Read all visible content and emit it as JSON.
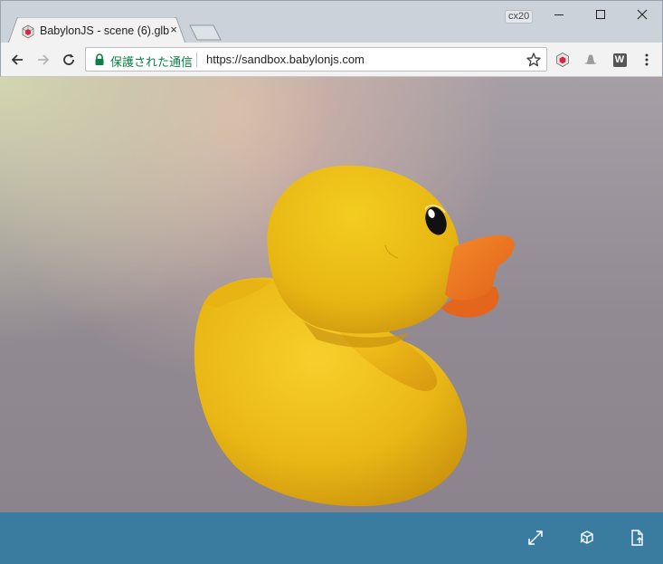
{
  "browser": {
    "tab": {
      "title": "BabylonJS - scene (6).glb",
      "favicon": "babylonjs-cube-icon",
      "close_label": "×"
    },
    "profile_badge": "cx20",
    "window_controls": {
      "minimize": "minimize-icon",
      "maximize": "maximize-icon",
      "close": "close-window-icon"
    }
  },
  "toolbar": {
    "back": "back-arrow-icon",
    "forward": "forward-arrow-icon",
    "reload": "reload-icon",
    "security_label": "保護された通信",
    "url": "https://sandbox.babylonjs.com",
    "bookmark": "star-icon",
    "extensions": [
      "babylonjs-extension-icon",
      "hat-extension-icon",
      "w-extension-icon"
    ],
    "extension_w_label": "W",
    "menu": "kebab-menu-icon"
  },
  "viewport": {
    "model": "rubber-duck",
    "colors": {
      "duck_body": "#f2c21a",
      "duck_beak": "#f07a1e",
      "duck_eye": "#111111",
      "background_dark": "#8c848c",
      "background_light": "#d6d9b0"
    }
  },
  "footer": {
    "color": "#3a7ca0",
    "buttons": [
      "fullscreen-icon",
      "inspector-cube-icon",
      "upload-file-icon"
    ]
  }
}
